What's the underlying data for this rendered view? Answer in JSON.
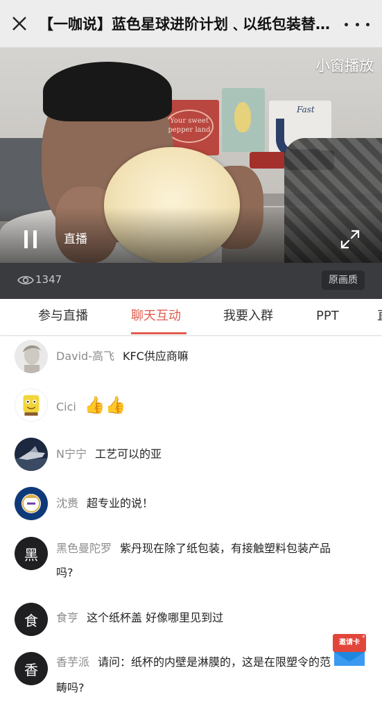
{
  "header": {
    "title": "【一咖说】蓝色星球进阶计划﹑以纸包装替代塑料包装",
    "close_icon": "close-icon",
    "more_icon": "more-dots-icon"
  },
  "video": {
    "mini_window_label": "小窗播放",
    "live_label": "直播",
    "product_box_text": "Your sweet pepper land",
    "fast_box_text": "Fast",
    "status_icon": "pause-icon",
    "fullscreen_icon": "fullscreen-icon"
  },
  "stats": {
    "views": "1347",
    "quality_label": "原画质"
  },
  "tabs": [
    {
      "label": "参与直播",
      "active": false
    },
    {
      "label": "聊天互动",
      "active": true
    },
    {
      "label": "我要入群",
      "active": false
    },
    {
      "label": "PPT",
      "active": false
    },
    {
      "label": "直",
      "active": false
    }
  ],
  "messages": [
    {
      "nick": "David-高飞",
      "text": "KFC供应商嘛"
    },
    {
      "nick": "Cici",
      "text": "👍👍"
    },
    {
      "nick": "N宁宁",
      "text": "工艺可以的亚"
    },
    {
      "nick": "沈赉",
      "text": "超专业的说！"
    },
    {
      "nick": "黑色曼陀罗",
      "avatar_text": "黑",
      "text": "紫丹现在除了纸包装，有接触塑料包装产品",
      "text_cont": "吗?"
    },
    {
      "nick": "食亨",
      "avatar_text": "食",
      "text": "这个纸杯盖 好像哪里见到过"
    },
    {
      "nick": "香芋派",
      "avatar_text": "香",
      "text": "请问：纸杯的内壁是淋膜的，这是在限塑令的范",
      "text_cont": "畴吗?"
    }
  ],
  "fab": {
    "label": "邀请卡"
  },
  "colors": {
    "accent": "#e05b4c",
    "fab_red": "#e2463b",
    "fab_blue": "#1e87e0"
  }
}
